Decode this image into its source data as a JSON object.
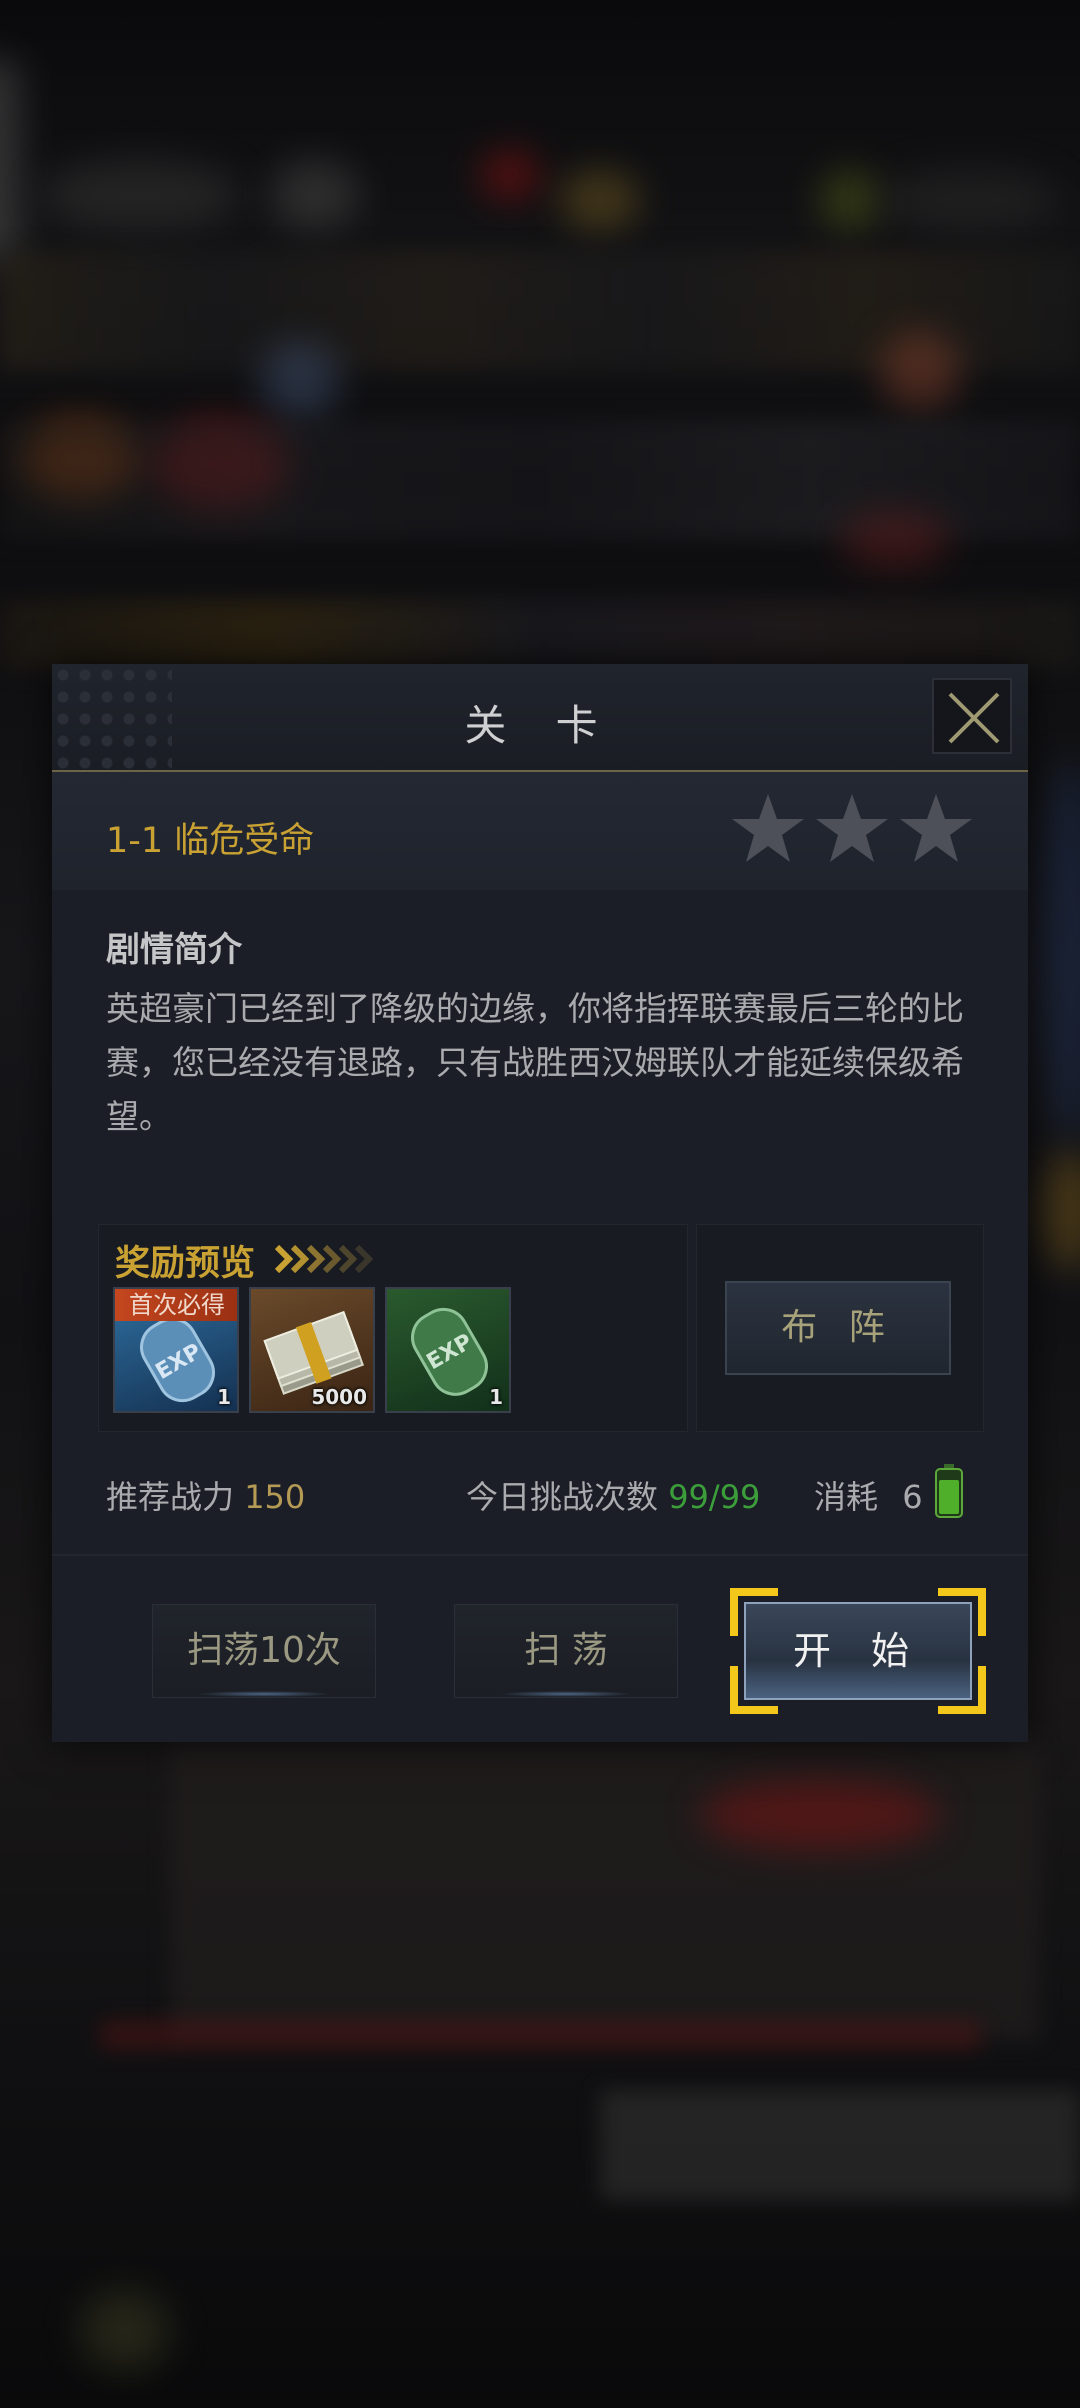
{
  "dialog": {
    "title": "关 卡",
    "level_name": "1-1  临危受命",
    "stars": 3,
    "synopsis_title": "剧情简介",
    "synopsis_text": "英超豪门已经到了降级的边缘，你将指挥联赛最后三轮的比赛，您已经没有退路，只有战胜西汉姆联队才能延续保级希望。",
    "reward_title": "奖励预览",
    "rewards": [
      {
        "name": "exp-card-blue",
        "count": "1",
        "tag": "首次必得"
      },
      {
        "name": "cash-bundle",
        "count": "5000"
      },
      {
        "name": "exp-card-green",
        "count": "1"
      }
    ],
    "formation_label": "布 阵",
    "recommend_label": "推荐战力",
    "recommend_value": "150",
    "challenges_label": "今日挑战次数",
    "challenges_value": "99/99",
    "cost_label": "消耗",
    "cost_value": "6",
    "sweep10_label": "扫荡10次",
    "sweep_label": "扫  荡",
    "start_label": "开 始"
  },
  "colors": {
    "gold": "#c9a233",
    "green": "#3b9e3b",
    "highlight": "#f3c81a"
  }
}
